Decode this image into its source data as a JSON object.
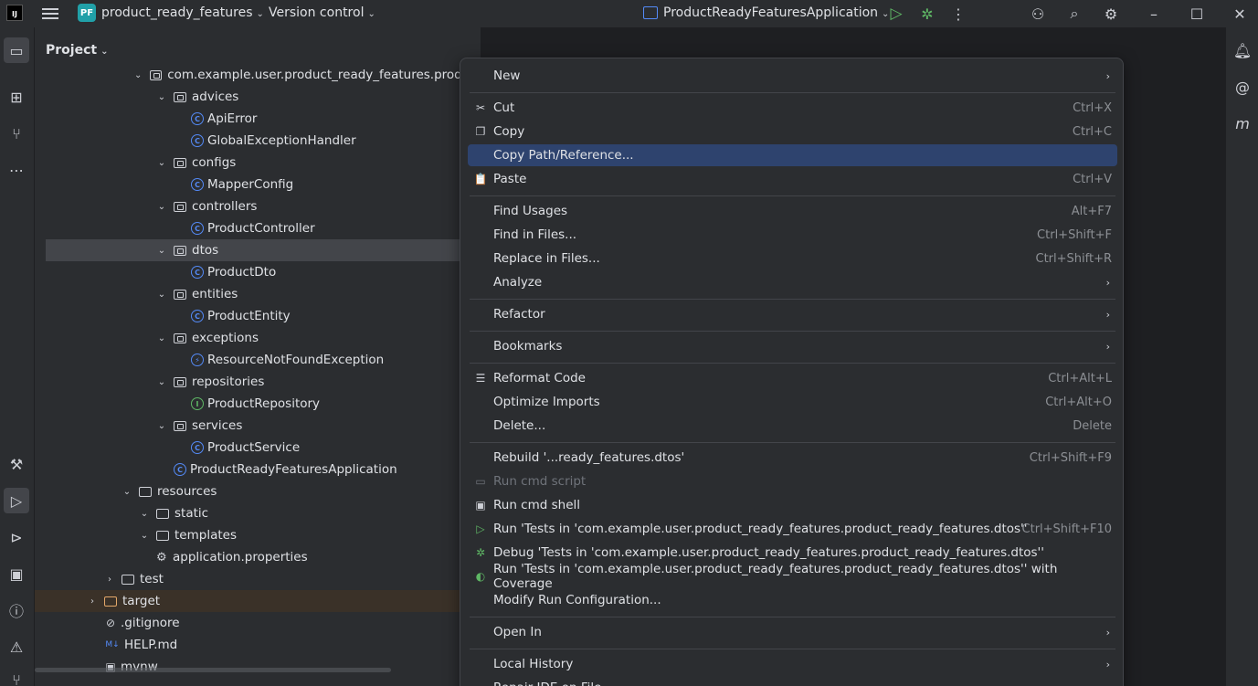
{
  "titlebar": {
    "project_badge": "PF",
    "project_name": "product_ready_features",
    "version_control": "Version control",
    "run_config": "ProductReadyFeaturesApplication"
  },
  "project_panel": {
    "title": "Project",
    "tree": [
      {
        "label": "com.example.user.product_ready_features.product",
        "type": "pkg",
        "indent": 3,
        "expanded": true
      },
      {
        "label": "advices",
        "type": "pkg",
        "indent": 4,
        "expanded": true
      },
      {
        "label": "ApiError",
        "type": "class",
        "indent": 5
      },
      {
        "label": "GlobalExceptionHandler",
        "type": "class",
        "indent": 5
      },
      {
        "label": "configs",
        "type": "pkg",
        "indent": 4,
        "expanded": true
      },
      {
        "label": "MapperConfig",
        "type": "class",
        "indent": 5
      },
      {
        "label": "controllers",
        "type": "pkg",
        "indent": 4,
        "expanded": true
      },
      {
        "label": "ProductController",
        "type": "class",
        "indent": 5
      },
      {
        "label": "dtos",
        "type": "pkg",
        "indent": 4,
        "expanded": true,
        "selected": true
      },
      {
        "label": "ProductDto",
        "type": "class",
        "indent": 5
      },
      {
        "label": "entities",
        "type": "pkg",
        "indent": 4,
        "expanded": true
      },
      {
        "label": "ProductEntity",
        "type": "class",
        "indent": 5
      },
      {
        "label": "exceptions",
        "type": "pkg",
        "indent": 4,
        "expanded": true
      },
      {
        "label": "ResourceNotFoundException",
        "type": "exc",
        "indent": 5
      },
      {
        "label": "repositories",
        "type": "pkg",
        "indent": 4,
        "expanded": true
      },
      {
        "label": "ProductRepository",
        "type": "iface",
        "indent": 5
      },
      {
        "label": "services",
        "type": "pkg",
        "indent": 4,
        "expanded": true
      },
      {
        "label": "ProductService",
        "type": "class",
        "indent": 5
      },
      {
        "label": "ProductReadyFeaturesApplication",
        "type": "app",
        "indent": 4
      },
      {
        "label": "resources",
        "type": "folder",
        "indent": 2,
        "expanded": true
      },
      {
        "label": "static",
        "type": "folder",
        "indent": 3
      },
      {
        "label": "templates",
        "type": "folder",
        "indent": 3
      },
      {
        "label": "application.properties",
        "type": "gear",
        "indent": 3
      },
      {
        "label": "test",
        "type": "folder",
        "indent": 1,
        "collapsed": true
      },
      {
        "label": "target",
        "type": "target",
        "indent": 0,
        "collapsed": true,
        "excluded": true
      },
      {
        "label": ".gitignore",
        "type": "ignore",
        "indent": 0
      },
      {
        "label": "HELP.md",
        "type": "md",
        "indent": 0
      },
      {
        "label": "mvnw",
        "type": "term",
        "indent": 0
      }
    ]
  },
  "context_menu": {
    "items": [
      {
        "label": "New",
        "arrow": true,
        "sep_after": true
      },
      {
        "label": "Cut",
        "shortcut": "Ctrl+X",
        "icon": "✂"
      },
      {
        "label": "Copy",
        "shortcut": "Ctrl+C",
        "icon": "❐"
      },
      {
        "label": "Copy Path/Reference...",
        "highlight": true
      },
      {
        "label": "Paste",
        "shortcut": "Ctrl+V",
        "icon": "📋",
        "sep_after": true
      },
      {
        "label": "Find Usages",
        "shortcut": "Alt+F7"
      },
      {
        "label": "Find in Files...",
        "shortcut": "Ctrl+Shift+F"
      },
      {
        "label": "Replace in Files...",
        "shortcut": "Ctrl+Shift+R"
      },
      {
        "label": "Analyze",
        "arrow": true,
        "sep_after": true
      },
      {
        "label": "Refactor",
        "arrow": true,
        "sep_after": true
      },
      {
        "label": "Bookmarks",
        "arrow": true,
        "sep_after": true
      },
      {
        "label": "Reformat Code",
        "shortcut": "Ctrl+Alt+L",
        "icon": "☰"
      },
      {
        "label": "Optimize Imports",
        "shortcut": "Ctrl+Alt+O"
      },
      {
        "label": "Delete...",
        "shortcut": "Delete",
        "sep_after": true
      },
      {
        "label": "Rebuild '...ready_features.dtos'",
        "shortcut": "Ctrl+Shift+F9"
      },
      {
        "label": "Run cmd script",
        "disabled": true,
        "icon": "▭"
      },
      {
        "label": "Run cmd shell",
        "icon": "▣"
      },
      {
        "label": "Run 'Tests in 'com.example.user.product_ready_features.product_ready_features.dtos''",
        "shortcut": "Ctrl+Shift+F10",
        "icon": "▷",
        "icon_color": "#5fb865"
      },
      {
        "label": "Debug 'Tests in 'com.example.user.product_ready_features.product_ready_features.dtos''",
        "icon": "✲",
        "icon_color": "#5fb865"
      },
      {
        "label": "Run 'Tests in 'com.example.user.product_ready_features.product_ready_features.dtos'' with Coverage",
        "icon": "◐",
        "icon_color": "#5fb865"
      },
      {
        "label": "Modify Run Configuration...",
        "sep_after": true
      },
      {
        "label": "Open In",
        "arrow": true,
        "sep_after": true
      },
      {
        "label": "Local History",
        "arrow": true
      },
      {
        "label": "Repair IDE on File"
      }
    ]
  },
  "colors": {
    "accent": "#548af7",
    "highlight": "#2e436e",
    "panel": "#2b2d30",
    "editor": "#1e1f22"
  }
}
